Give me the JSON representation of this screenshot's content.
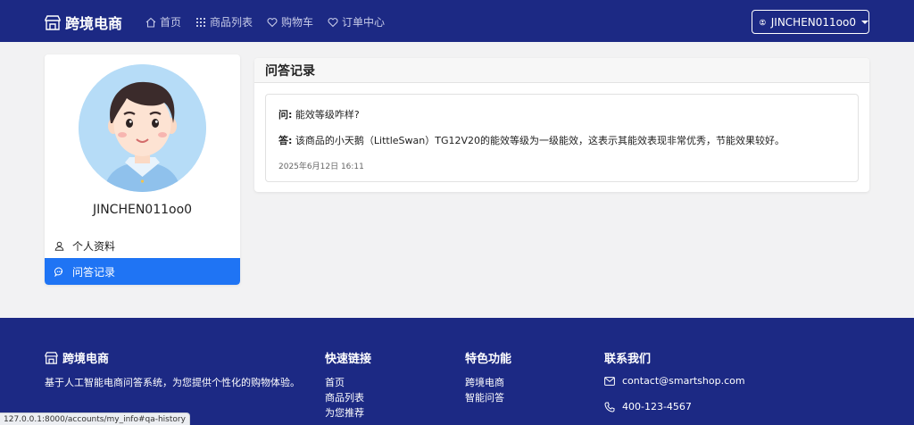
{
  "navbar": {
    "brand": "跨境电商",
    "links": [
      {
        "label": "首页",
        "icon": "home-icon"
      },
      {
        "label": "商品列表",
        "icon": "grid-icon"
      },
      {
        "label": "购物车",
        "icon": "heart-icon"
      },
      {
        "label": "订单中心",
        "icon": "heart-icon"
      }
    ],
    "user": "JINCHEN011oo0"
  },
  "profile": {
    "name": "JINCHEN011oo0",
    "menu": [
      {
        "label": "个人资料",
        "icon": "person-icon",
        "active": false
      },
      {
        "label": "问答记录",
        "icon": "chat-icon",
        "active": true
      }
    ]
  },
  "qa": {
    "title": "问答记录",
    "items": [
      {
        "q_prefix": "问:",
        "question": "能效等级咋样?",
        "a_prefix": "答:",
        "answer": "该商品的小天鹅（LittleSwan）TG12V20的能效等级为一级能效，这表示其能效表现非常优秀，节能效果较好。",
        "time": "2025年6月12日 16:11"
      }
    ]
  },
  "footer": {
    "brand": "跨境电商",
    "description": "基于人工智能电商问答系统，为您提供个性化的购物体验。",
    "quick_links": {
      "title": "快速链接",
      "items": [
        "首页",
        "商品列表",
        "为您推荐"
      ]
    },
    "features": {
      "title": "特色功能",
      "items": [
        "跨境电商",
        "智能问答"
      ]
    },
    "contact": {
      "title": "联系我们",
      "email": "contact@smartshop.com",
      "phone": "400-123-4567"
    }
  },
  "status_bar": {
    "url": "127.0.0.1:8000/accounts/my_info#qa-history"
  },
  "colors": {
    "navbar": "#1c2984",
    "accent": "#1f74f4",
    "page_bg": "#f2f2f3"
  }
}
